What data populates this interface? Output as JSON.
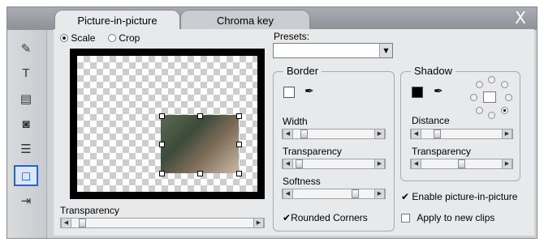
{
  "window": {
    "close_glyph": "X"
  },
  "tabs": [
    {
      "label": "Picture-in-picture",
      "active": true
    },
    {
      "label": "Chroma key",
      "active": false
    }
  ],
  "rail_icons": [
    "wand-icon",
    "title-icon",
    "notes-icon",
    "camera-icon",
    "stack-icon",
    "pip-icon",
    "audio-clip-icon"
  ],
  "mode": {
    "scale_label": "Scale",
    "crop_label": "Crop",
    "selected": "Scale"
  },
  "presets": {
    "label": "Presets:",
    "value": ""
  },
  "preview": {
    "transparency_label": "Transparency",
    "transparency_value": 0.05
  },
  "border": {
    "title": "Border",
    "color": "#ffffff",
    "width_label": "Width",
    "width_value": 0.12,
    "transparency_label": "Transparency",
    "transparency_value": 0.05,
    "softness_label": "Softness",
    "softness_value": 0.78,
    "rounded_label": "Rounded Corners",
    "rounded_checked": true
  },
  "shadow": {
    "title": "Shadow",
    "color": "#000000",
    "distance_label": "Distance",
    "distance_value": 0.18,
    "transparency_label": "Transparency",
    "transparency_value": 0.5,
    "direction": "bottom-right"
  },
  "options": {
    "enable_label": "Enable picture-in-picture",
    "enable_checked": true,
    "apply_label": "Apply to new clips",
    "apply_checked": false
  }
}
